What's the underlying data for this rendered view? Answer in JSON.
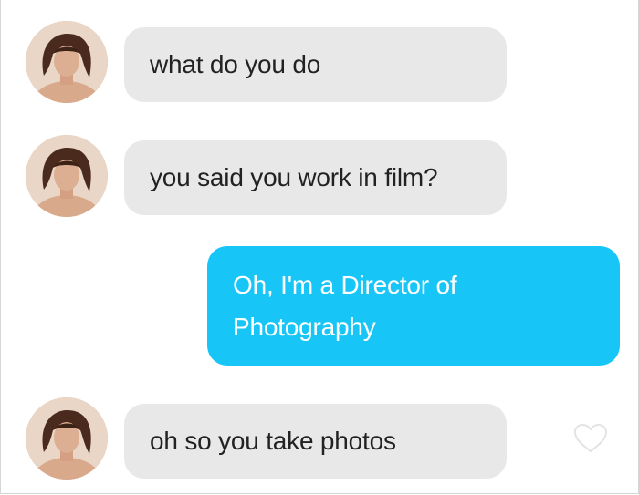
{
  "conversation": {
    "messages": [
      {
        "direction": "incoming",
        "text": "what do you do"
      },
      {
        "direction": "incoming",
        "text": "you said you work in film?"
      },
      {
        "direction": "outgoing",
        "line1": "Oh, I'm a Director of",
        "line2": "Photography"
      },
      {
        "direction": "incoming",
        "text": "oh so you take photos"
      }
    ]
  },
  "colors": {
    "incoming_bubble": "#e8e8e8",
    "outgoing_bubble": "#17c6f7",
    "outgoing_text": "#ffffff"
  },
  "icons": {
    "avatar": "contact-avatar-photo",
    "like": "heart-outline-icon"
  }
}
